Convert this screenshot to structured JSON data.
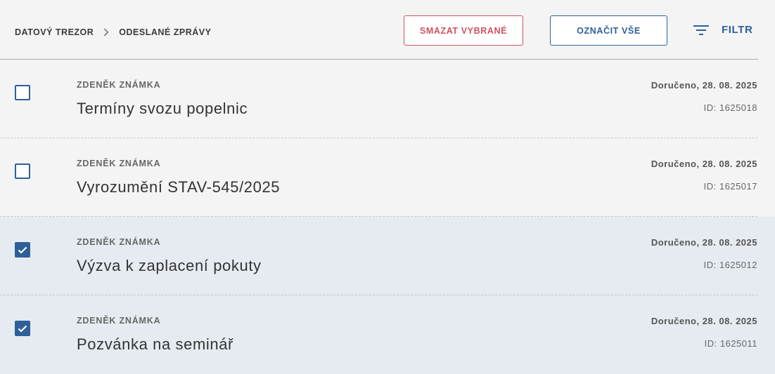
{
  "breadcrumb": {
    "items": [
      "DATOVÝ TREZOR",
      "ODESLANÉ ZPRÁVY"
    ]
  },
  "toolbar": {
    "delete_label": "SMAZAT VYBRANÉ",
    "select_all_label": "OZNAČIT VŠE",
    "filter_label": "FILTR",
    "filter_icon": "filter-icon"
  },
  "colors": {
    "primary": "#2e5f99",
    "danger": "#d0525d",
    "selected_row_bg": "#e6ebf1",
    "page_bg": "#f4f4f4"
  },
  "messages": [
    {
      "sender": "ZDENĚK ZNÁMKA",
      "subject": "Termíny svozu popelnic",
      "delivered": "Doručeno, 28. 08. 2025",
      "id": "ID: 1625018",
      "checked": false
    },
    {
      "sender": "ZDENĚK ZNÁMKA",
      "subject": "Vyrozumění STAV-545/2025",
      "delivered": "Doručeno, 28. 08. 2025",
      "id": "ID: 1625017",
      "checked": false
    },
    {
      "sender": "ZDENĚK ZNÁMKA",
      "subject": "Výzva k zaplacení pokuty",
      "delivered": "Doručeno, 28. 08. 2025",
      "id": "ID: 1625012",
      "checked": true
    },
    {
      "sender": "ZDENĚK ZNÁMKA",
      "subject": "Pozvánka na seminář",
      "delivered": "Doručeno, 28. 08. 2025",
      "id": "ID: 1625011",
      "checked": true
    }
  ]
}
